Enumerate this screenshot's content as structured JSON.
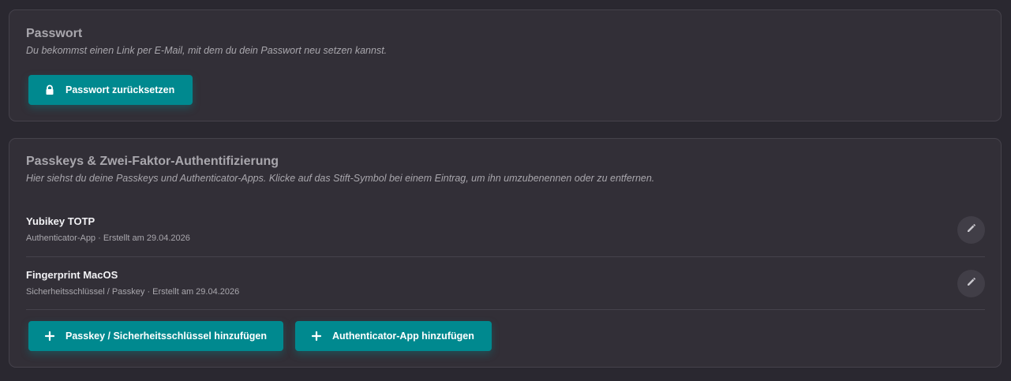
{
  "password": {
    "title": "Passwort",
    "subtitle": "Du bekommst einen Link per E-Mail, mit dem du dein Passwort neu setzen kannst.",
    "reset_button": "Passwort zurücksetzen"
  },
  "passkeys": {
    "title": "Passkeys & Zwei-Faktor-Authentifizierung",
    "subtitle": "Hier siehst du deine Passkeys und Authenticator-Apps. Klicke auf das Stift-Symbol bei einem Eintrag, um ihn umzubenennen oder zu entfernen.",
    "entries": [
      {
        "name": "Yubikey TOTP",
        "meta": "Authenticator-App · Erstellt am 29.04.2026"
      },
      {
        "name": "Fingerprint MacOS",
        "meta": "Sicherheitsschlüssel / Passkey · Erstellt am 29.04.2026"
      }
    ],
    "add_passkey_button": "Passkey / Sicherheitsschlüssel hinzufügen",
    "add_app_button": "Authenticator-App hinzufügen"
  },
  "icons": {
    "lock": "lock-icon",
    "plus": "plus-icon",
    "edit": "pencil-icon"
  },
  "colors": {
    "accent": "#00898f",
    "card_background": "#322f37",
    "page_background": "#2a2830"
  }
}
